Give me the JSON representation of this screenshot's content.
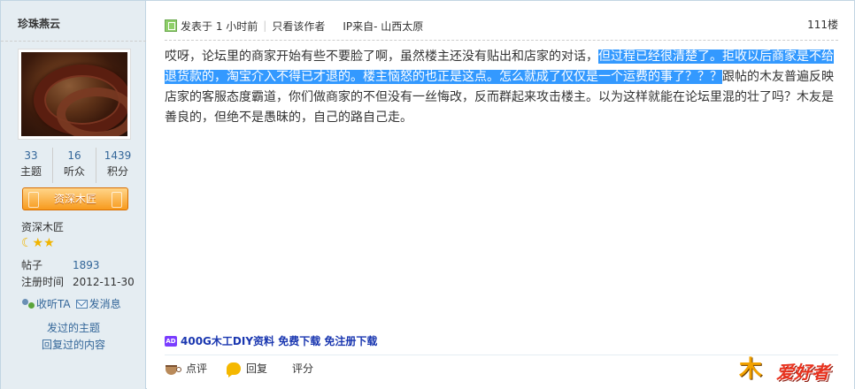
{
  "author": {
    "name": "珍珠燕云",
    "stats": [
      {
        "num": "33",
        "label": "主题"
      },
      {
        "num": "16",
        "label": "听众"
      },
      {
        "num": "1439",
        "label": "积分"
      }
    ],
    "rank_badge": "资深木匠",
    "rank_title": "资深木匠",
    "stars": "☾★★",
    "posts_label": "帖子",
    "posts_value": "1893",
    "reg_label": "注册时间",
    "reg_value": "2012-11-30",
    "follow_label": "收听TA",
    "message_label": "发消息",
    "link_topics": "发过的主题",
    "link_replies": "回复过的内容"
  },
  "post": {
    "posted": "发表于 1 小时前",
    "only_author": "只看该作者",
    "ip_from": "IP来自- 山西太原",
    "floor": "111楼",
    "content_before": "哎呀，论坛里的商家开始有些不要脸了啊，虽然楼主还没有贴出和店家的对话，",
    "content_highlight": "但过程已经很清楚了。拒收以后商家是不给退货款的，淘宝介入不得已才退的。楼主恼怒的也正是这点。怎么就成了仅仅是一个运费的事了？？？",
    "content_after": "跟帖的木友普遍反映店家的客服态度霸道，你们做商家的不但没有一丝悔改，反而群起来攻击楼主。以为这样就能在论坛里混的壮了吗？木友是善良的，但绝不是愚昧的，自己的路自己走。"
  },
  "ad": {
    "icon": "AD",
    "text": "400G木工DIY资料 免费下载 免注册下载"
  },
  "actions": {
    "rate": "点评",
    "reply": "回复",
    "score": "评分"
  },
  "logo": {
    "mu": "木",
    "text": "爱好者"
  }
}
